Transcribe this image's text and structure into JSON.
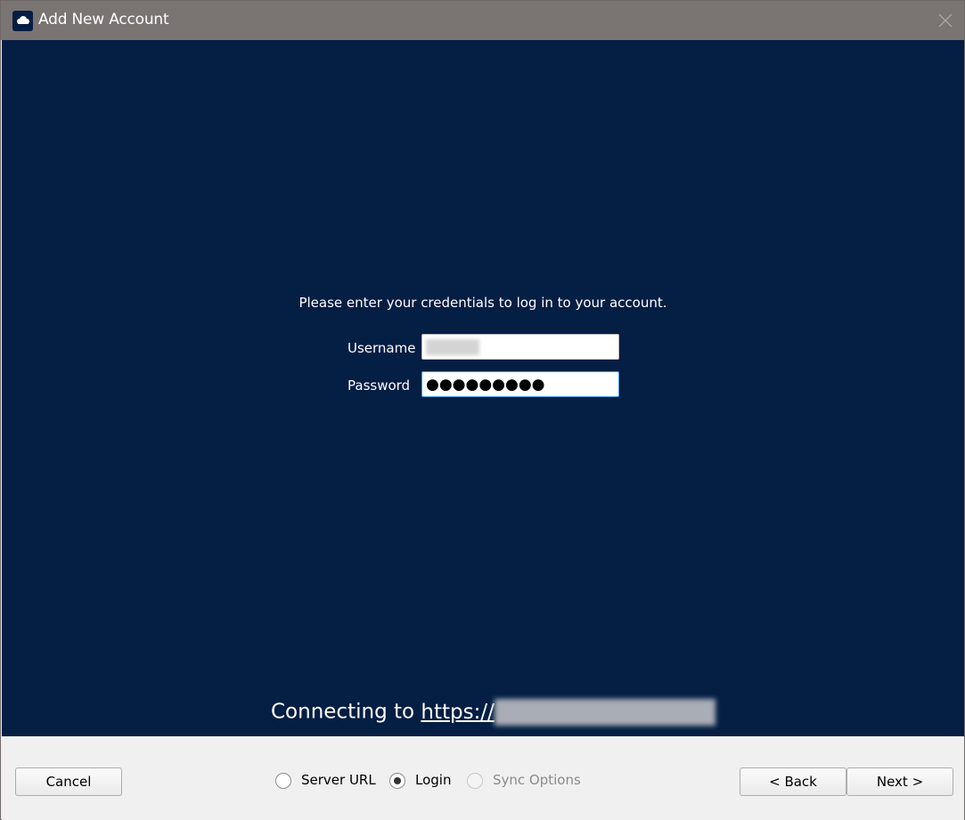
{
  "window": {
    "title": "Add New Account",
    "app_icon": "cloud-icon",
    "close_icon": "close-icon"
  },
  "login": {
    "instructions": "Please enter your credentials to log in to your account.",
    "username_label": "Username",
    "username_value_redacted": true,
    "password_label": "Password",
    "password_mask": "●●●●●●●●●"
  },
  "connection": {
    "prefix": "Connecting to ",
    "link_visible": "https://",
    "host_redacted": true
  },
  "footer": {
    "cancel_label": "Cancel",
    "back_label": "< Back",
    "next_label": "Next >",
    "steps": [
      {
        "label": "Server URL",
        "checked": false,
        "enabled": true
      },
      {
        "label": "Login",
        "checked": true,
        "enabled": true
      },
      {
        "label": "Sync Options",
        "checked": false,
        "enabled": false
      }
    ]
  },
  "colors": {
    "content_bg": "#041e44",
    "titlebar_bg": "#7a7472",
    "focus_border": "#3c9ee8"
  }
}
